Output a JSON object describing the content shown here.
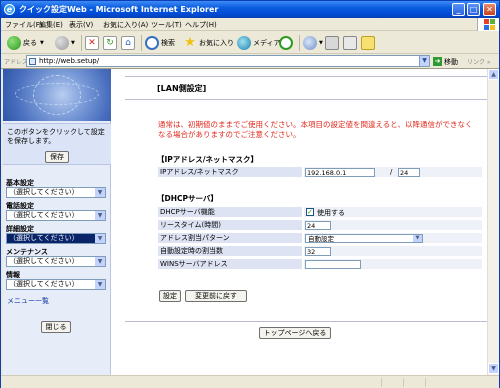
{
  "window": {
    "title": "クイック設定Web - Microsoft Internet Explorer",
    "minimize": "_",
    "maximize": "□",
    "close": "✕"
  },
  "menu": [
    "ファイル(F)",
    "編集(E)",
    "表示(V)",
    "お気に入り(A)",
    "ツール(T)",
    "ヘルプ(H)"
  ],
  "toolbar": {
    "back": "戻る",
    "search": "検索",
    "favorites": "お気に入り",
    "media": "メディア"
  },
  "address": {
    "label": "アドレス(D)",
    "url": "http://web.setup/",
    "go": "移動",
    "links": "リンク »"
  },
  "sidebar": {
    "save_text": "このボタンをクリックして設定を保存します。",
    "save_button": "保存",
    "sections": [
      {
        "label": "基本設定",
        "value": "（選択してください）",
        "selected": false
      },
      {
        "label": "電話設定",
        "value": "（選択してください）",
        "selected": false
      },
      {
        "label": "詳細設定",
        "value": "（選択してください）",
        "selected": true
      },
      {
        "label": "メンテナンス",
        "value": "（選択してください）",
        "selected": false
      },
      {
        "label": "情報",
        "value": "（選択してください）",
        "selected": false
      }
    ],
    "menu_link": "メニュー一覧",
    "close_button": "閉じる"
  },
  "main": {
    "title": "[LAN側設定]",
    "warning": "通常は、初期値のままでご使用ください。本項目の設定値を間違えると、以降通信ができなくなる場合がありますのでご注意ください。",
    "ip_section": "【IPアドレス/ネットマスク】",
    "ip_label": "IPアドレス/ネットマスク",
    "ip_value": "192.168.0.1",
    "slash": "/",
    "mask_value": "24",
    "dhcp_section": "【DHCPサーバ】",
    "dhcp_rows": {
      "func_label": "DHCPサーバ機能",
      "func_value": "使用する",
      "lease_label": "リースタイム(時間)",
      "lease_value": "24",
      "pattern_label": "アドレス割当パターン",
      "pattern_value": "自動設定",
      "count_label": "自動設定時の割当数",
      "count_value": "32",
      "wins_label": "WINSサーバアドレス",
      "wins_value": ""
    },
    "set_button": "設定",
    "revert_button": "変更前に戻す",
    "top_button": "トップページへ戻る"
  },
  "colors": {
    "accent": "#0a246a",
    "warning": "#e0281c",
    "label_bg": "#dde3f3",
    "value_bg": "#eef1f8"
  }
}
